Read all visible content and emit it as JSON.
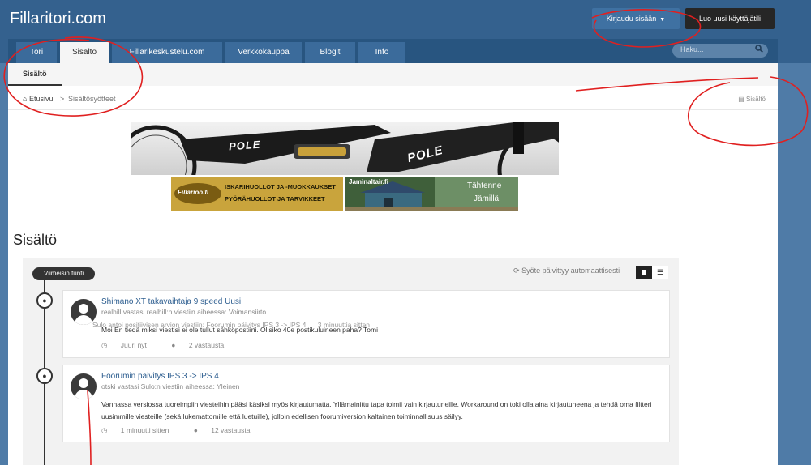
{
  "header": {
    "site_title": "Fillaritori.com",
    "login_label": "Kirjaudu sisään",
    "register_label": "Luo uusi käyttäjätili",
    "search_placeholder": "Haku..."
  },
  "nav": {
    "tabs": [
      {
        "label": "Tori"
      },
      {
        "label": "Sisältö"
      },
      {
        "label": "Fillarikeskustelu.com"
      },
      {
        "label": "Verkkokauppa"
      },
      {
        "label": "Blogit"
      },
      {
        "label": "Info"
      }
    ]
  },
  "subnav": {
    "item": "Sisältö"
  },
  "breadcrumb": {
    "home": "Etusivu",
    "separator": ">",
    "current": "Sisältösyötteet",
    "right_link": "Sisältö"
  },
  "banners": {
    "bike_text_1": "POLE",
    "bike_text_2": "POLE",
    "ad1_logo": "Fillarioo.fi",
    "ad1_line1": "ISKARIHUOLLOT JA -MUOKKAUKSET",
    "ad1_line2": "PYÖRÄHUOLLOT JA TARVIKKEET",
    "ad2_site": "Jaminaltair.fi",
    "ad2_line1": "Tähtenne",
    "ad2_line2": "Jämillä"
  },
  "page": {
    "heading": "Sisältö"
  },
  "stream": {
    "time_badge": "Viimeisin tunti",
    "auto_update": "Syöte päivittyy automaattisesti",
    "items": [
      {
        "title": "Shimano XT takavaihtaja 9 speed Uusi",
        "subtitle": "realhill vastasi realhill:n viestiin aiheessa: Voimansiirto",
        "body": "Moi En tiedä miksi viestisi ei ole tullut sähköpostiini. Olisiko 40e postikuluineen paha? Tomi",
        "time": "Juuri nyt",
        "replies": "2 vastausta"
      },
      {
        "title": "Foorumin päivitys IPS 3 -> IPS 4",
        "subtitle": "otski vastasi Sulo:n viestiin aiheessa: Yleinen",
        "body": "Vanhassa versiossa tuoreimpiin viesteihin pääsi käsiksi myös kirjautumatta. Yllämainittu tapa toimii vain kirjautuneille. Workaround on toki olla aina kirjautuneena ja tehdä oma filtteri uusimmille viesteille (sekä lukemattomille että luetuille), jolloin edellisen foorumiversion kaltainen toiminnallisuus säilyy.",
        "time": "1 minuutti sitten",
        "replies": "12 vastausta"
      }
    ],
    "activity": {
      "text": "Sulo antoi positiivisen arvion viestiin: Foorumin päivitys IPS 3 -> IPS 4",
      "time": "3 minuuttia sitten"
    }
  },
  "icons": {
    "home": "home-icon",
    "search": "search-icon",
    "refresh": "refresh-icon",
    "comment": "comment-icon",
    "clock": "clock-icon",
    "speech": "speech-bubble-icon"
  },
  "colors": {
    "header_bg": "#34618e",
    "nav_bg": "#285580",
    "annotation": "#e02020"
  }
}
